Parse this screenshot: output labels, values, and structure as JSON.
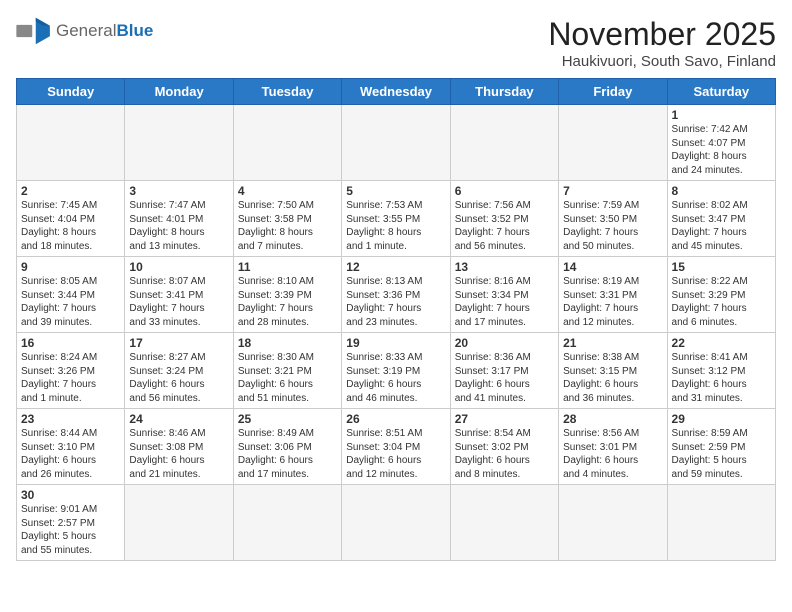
{
  "header": {
    "logo_general": "General",
    "logo_blue": "Blue",
    "month_title": "November 2025",
    "location": "Haukivuori, South Savo, Finland"
  },
  "weekdays": [
    "Sunday",
    "Monday",
    "Tuesday",
    "Wednesday",
    "Thursday",
    "Friday",
    "Saturday"
  ],
  "weeks": [
    [
      {
        "day": "",
        "info": ""
      },
      {
        "day": "",
        "info": ""
      },
      {
        "day": "",
        "info": ""
      },
      {
        "day": "",
        "info": ""
      },
      {
        "day": "",
        "info": ""
      },
      {
        "day": "",
        "info": ""
      },
      {
        "day": "1",
        "info": "Sunrise: 7:42 AM\nSunset: 4:07 PM\nDaylight: 8 hours\nand 24 minutes."
      }
    ],
    [
      {
        "day": "2",
        "info": "Sunrise: 7:45 AM\nSunset: 4:04 PM\nDaylight: 8 hours\nand 18 minutes."
      },
      {
        "day": "3",
        "info": "Sunrise: 7:47 AM\nSunset: 4:01 PM\nDaylight: 8 hours\nand 13 minutes."
      },
      {
        "day": "4",
        "info": "Sunrise: 7:50 AM\nSunset: 3:58 PM\nDaylight: 8 hours\nand 7 minutes."
      },
      {
        "day": "5",
        "info": "Sunrise: 7:53 AM\nSunset: 3:55 PM\nDaylight: 8 hours\nand 1 minute."
      },
      {
        "day": "6",
        "info": "Sunrise: 7:56 AM\nSunset: 3:52 PM\nDaylight: 7 hours\nand 56 minutes."
      },
      {
        "day": "7",
        "info": "Sunrise: 7:59 AM\nSunset: 3:50 PM\nDaylight: 7 hours\nand 50 minutes."
      },
      {
        "day": "8",
        "info": "Sunrise: 8:02 AM\nSunset: 3:47 PM\nDaylight: 7 hours\nand 45 minutes."
      }
    ],
    [
      {
        "day": "9",
        "info": "Sunrise: 8:05 AM\nSunset: 3:44 PM\nDaylight: 7 hours\nand 39 minutes."
      },
      {
        "day": "10",
        "info": "Sunrise: 8:07 AM\nSunset: 3:41 PM\nDaylight: 7 hours\nand 33 minutes."
      },
      {
        "day": "11",
        "info": "Sunrise: 8:10 AM\nSunset: 3:39 PM\nDaylight: 7 hours\nand 28 minutes."
      },
      {
        "day": "12",
        "info": "Sunrise: 8:13 AM\nSunset: 3:36 PM\nDaylight: 7 hours\nand 23 minutes."
      },
      {
        "day": "13",
        "info": "Sunrise: 8:16 AM\nSunset: 3:34 PM\nDaylight: 7 hours\nand 17 minutes."
      },
      {
        "day": "14",
        "info": "Sunrise: 8:19 AM\nSunset: 3:31 PM\nDaylight: 7 hours\nand 12 minutes."
      },
      {
        "day": "15",
        "info": "Sunrise: 8:22 AM\nSunset: 3:29 PM\nDaylight: 7 hours\nand 6 minutes."
      }
    ],
    [
      {
        "day": "16",
        "info": "Sunrise: 8:24 AM\nSunset: 3:26 PM\nDaylight: 7 hours\nand 1 minute."
      },
      {
        "day": "17",
        "info": "Sunrise: 8:27 AM\nSunset: 3:24 PM\nDaylight: 6 hours\nand 56 minutes."
      },
      {
        "day": "18",
        "info": "Sunrise: 8:30 AM\nSunset: 3:21 PM\nDaylight: 6 hours\nand 51 minutes."
      },
      {
        "day": "19",
        "info": "Sunrise: 8:33 AM\nSunset: 3:19 PM\nDaylight: 6 hours\nand 46 minutes."
      },
      {
        "day": "20",
        "info": "Sunrise: 8:36 AM\nSunset: 3:17 PM\nDaylight: 6 hours\nand 41 minutes."
      },
      {
        "day": "21",
        "info": "Sunrise: 8:38 AM\nSunset: 3:15 PM\nDaylight: 6 hours\nand 36 minutes."
      },
      {
        "day": "22",
        "info": "Sunrise: 8:41 AM\nSunset: 3:12 PM\nDaylight: 6 hours\nand 31 minutes."
      }
    ],
    [
      {
        "day": "23",
        "info": "Sunrise: 8:44 AM\nSunset: 3:10 PM\nDaylight: 6 hours\nand 26 minutes."
      },
      {
        "day": "24",
        "info": "Sunrise: 8:46 AM\nSunset: 3:08 PM\nDaylight: 6 hours\nand 21 minutes."
      },
      {
        "day": "25",
        "info": "Sunrise: 8:49 AM\nSunset: 3:06 PM\nDaylight: 6 hours\nand 17 minutes."
      },
      {
        "day": "26",
        "info": "Sunrise: 8:51 AM\nSunset: 3:04 PM\nDaylight: 6 hours\nand 12 minutes."
      },
      {
        "day": "27",
        "info": "Sunrise: 8:54 AM\nSunset: 3:02 PM\nDaylight: 6 hours\nand 8 minutes."
      },
      {
        "day": "28",
        "info": "Sunrise: 8:56 AM\nSunset: 3:01 PM\nDaylight: 6 hours\nand 4 minutes."
      },
      {
        "day": "29",
        "info": "Sunrise: 8:59 AM\nSunset: 2:59 PM\nDaylight: 5 hours\nand 59 minutes."
      }
    ],
    [
      {
        "day": "30",
        "info": "Sunrise: 9:01 AM\nSunset: 2:57 PM\nDaylight: 5 hours\nand 55 minutes."
      },
      {
        "day": "",
        "info": ""
      },
      {
        "day": "",
        "info": ""
      },
      {
        "day": "",
        "info": ""
      },
      {
        "day": "",
        "info": ""
      },
      {
        "day": "",
        "info": ""
      },
      {
        "day": "",
        "info": ""
      }
    ]
  ]
}
